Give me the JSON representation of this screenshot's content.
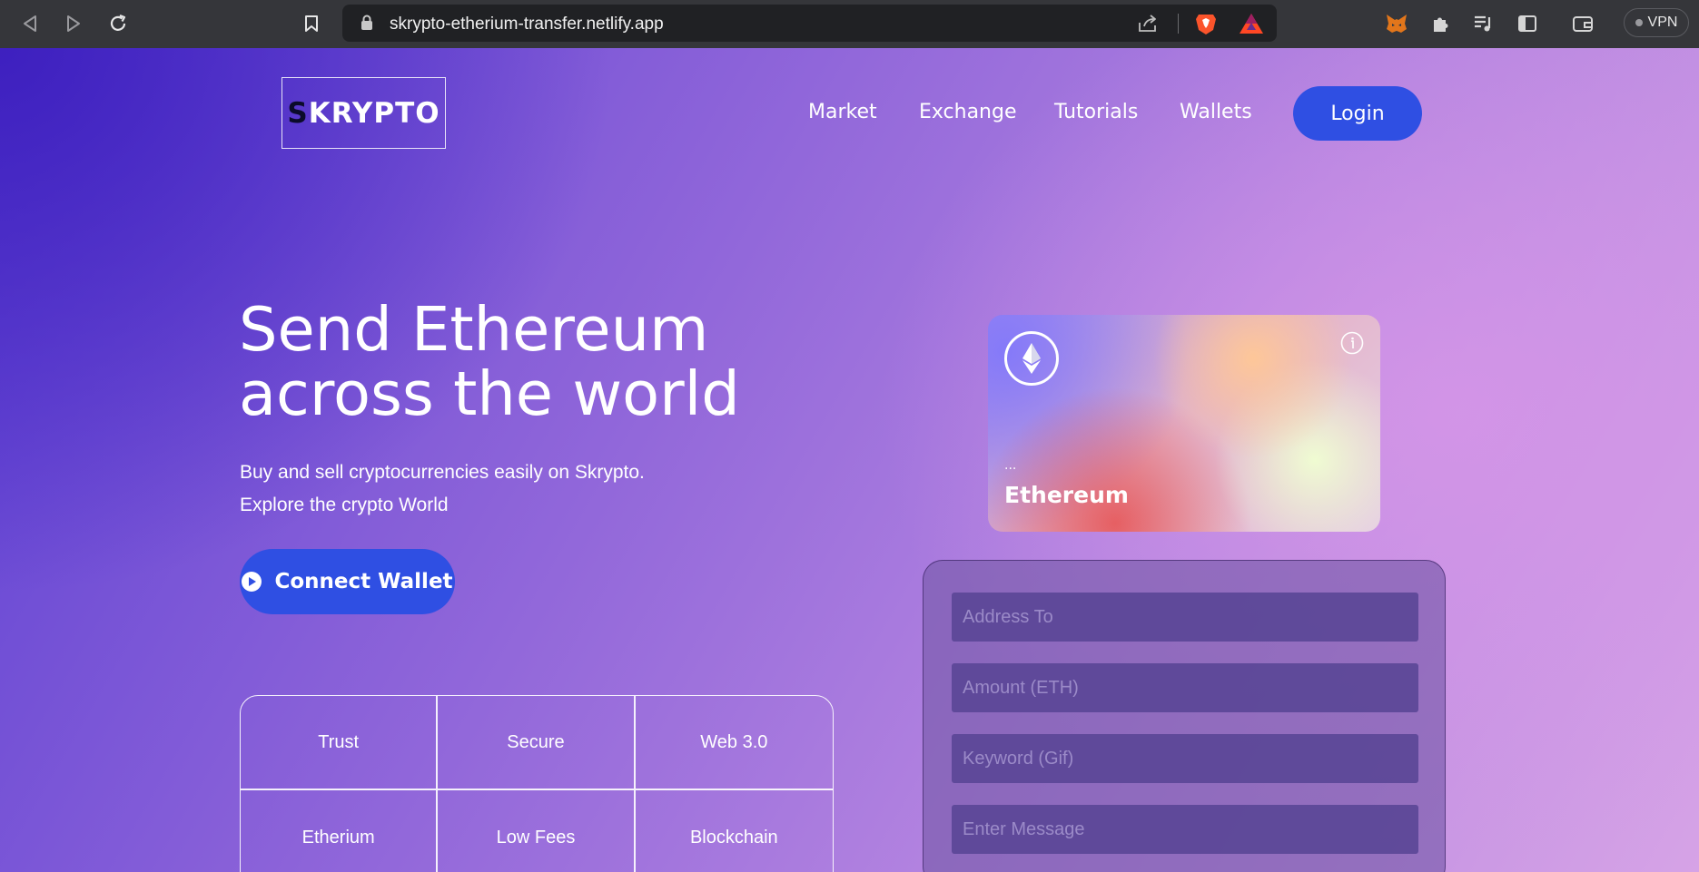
{
  "browser": {
    "url": "skrypto-etherium-transfer.netlify.app",
    "vpn_label": "VPN"
  },
  "header": {
    "logo_first": "S",
    "logo_rest": "KRYPTO",
    "nav": [
      "Market",
      "Exchange",
      "Tutorials",
      "Wallets"
    ],
    "login_label": "Login"
  },
  "hero": {
    "title_line1": "Send Ethereum",
    "title_line2": "across the world",
    "subtitle_line1": "Buy and sell cryptocurrencies easily on Skrypto.",
    "subtitle_line2": "Explore the crypto World",
    "connect_label": "Connect Wallet"
  },
  "features": [
    "Trust",
    "Secure",
    "Web 3.0",
    "Etherium",
    "Low Fees",
    "Blockchain"
  ],
  "card": {
    "address": "...",
    "name": "Ethereum"
  },
  "form": {
    "address_placeholder": "Address To",
    "amount_placeholder": "Amount (ETH)",
    "keyword_placeholder": "Keyword (Gif)",
    "message_placeholder": "Enter Message"
  },
  "colors": {
    "accent": "#2f4fe3",
    "chrome": "#35363a",
    "urlbar": "#202124"
  }
}
